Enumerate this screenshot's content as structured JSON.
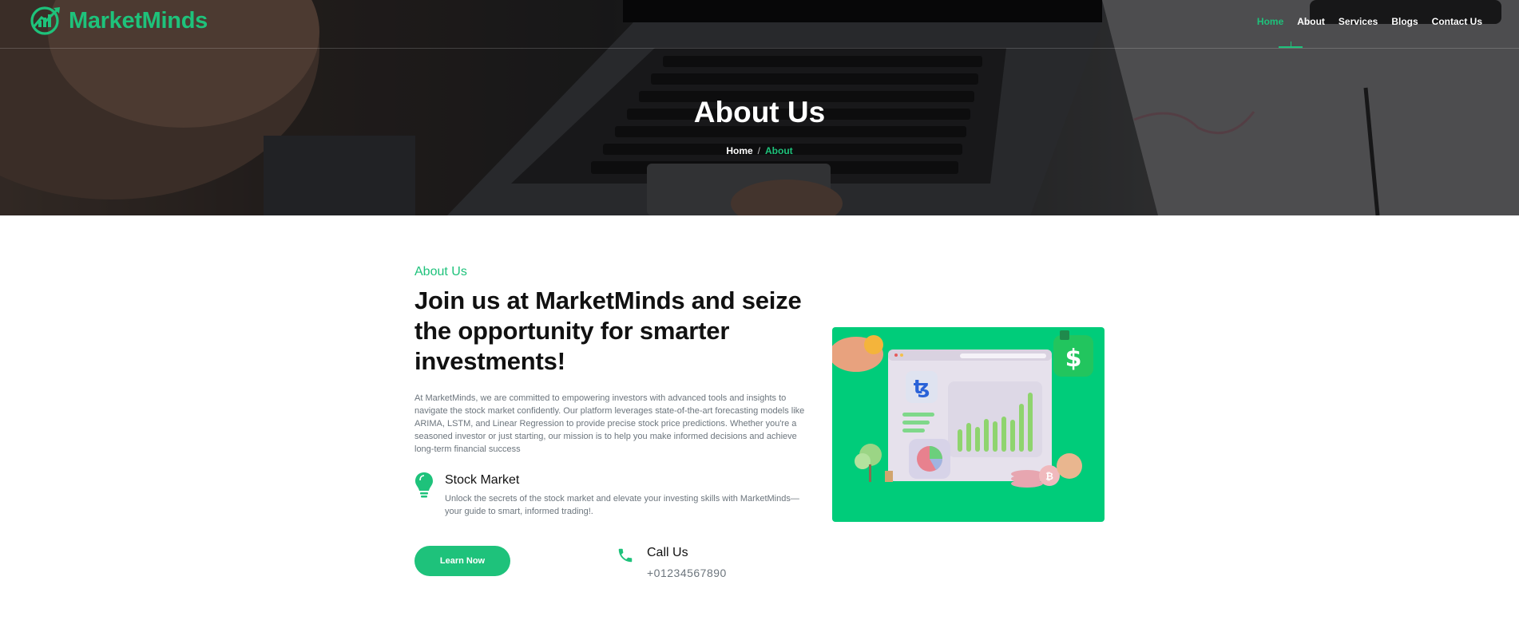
{
  "header": {
    "brand_name": "MarketMinds",
    "logo_icon": "growth-chart-logo-icon",
    "nav": [
      {
        "label": "Home",
        "active": true
      },
      {
        "label": "About",
        "active": false
      },
      {
        "label": "Services",
        "active": false
      },
      {
        "label": "Blogs",
        "active": false
      },
      {
        "label": "Contact Us",
        "active": false
      }
    ]
  },
  "hero": {
    "title": "About Us",
    "breadcrumb": {
      "home": "Home",
      "separator": "/",
      "current": "About"
    }
  },
  "about": {
    "eyebrow": "About Us",
    "heading": "Join us at MarketMinds and seize the opportunity for smarter investments!",
    "description": "At MarketMinds, we are committed to empowering investors with advanced tools and insights to navigate the stock market confidently. Our platform leverages state-of-the-art forecasting models like ARIMA, LSTM, and Linear Regression to provide precise stock price predictions. Whether you're a seasoned investor or just starting, our mission is to help you make informed decisions and achieve long-term financial success",
    "feature": {
      "icon": "lightbulb-icon",
      "title": "Stock Market",
      "description": "Unlock the secrets of the stock market and elevate your investing skills with MarketMinds—your guide to smart, informed trading!."
    },
    "cta_label": "Learn Now",
    "call": {
      "icon": "phone-icon",
      "title": "Call Us",
      "number": "+01234567890"
    }
  },
  "colors": {
    "accent": "#1ec27b",
    "illustration_bg": "#00cc7a",
    "text_dark": "#111111",
    "text_muted": "#6c757d"
  }
}
